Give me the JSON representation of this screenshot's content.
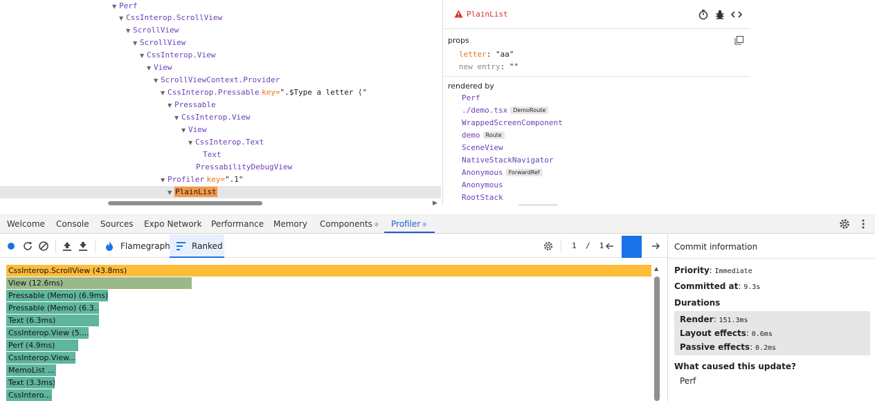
{
  "tree": {
    "rows": [
      {
        "name": "Perf"
      },
      {
        "name": "CssInterop.ScrollView"
      },
      {
        "name": "ScrollView"
      },
      {
        "name": "ScrollView"
      },
      {
        "name": "CssInterop.View"
      },
      {
        "name": "View"
      },
      {
        "name": "ScrollViewContext.Provider"
      },
      {
        "name": "CssInterop.Pressable",
        "key_label": "key=",
        "key_value": "\".$Type a letter ⟨\""
      },
      {
        "name": "Pressable"
      },
      {
        "name": "CssInterop.View"
      },
      {
        "name": "View"
      },
      {
        "name": "CssInterop.Text"
      },
      {
        "name": "Text"
      },
      {
        "name": "PressabilityDebugView"
      },
      {
        "name": "Profiler",
        "key_label": "key=",
        "key_value": "\".1\""
      },
      {
        "name": "PlainList"
      }
    ]
  },
  "inspector": {
    "title": "PlainList",
    "icons": [
      "stopwatch-icon",
      "bug-icon",
      "code-icon"
    ],
    "props_title": "props",
    "props": [
      {
        "key": "letter",
        "value": "\"aa\""
      },
      {
        "key": "new entry",
        "value": "\"\""
      }
    ],
    "rendered_by_title": "rendered by",
    "owners": [
      {
        "name": "Perf",
        "badge": ""
      },
      {
        "name": "./demo.tsx",
        "badge": "DemoRoute"
      },
      {
        "name": "WrappedScreenComponent",
        "badge": ""
      },
      {
        "name": "demo",
        "badge": "Route"
      },
      {
        "name": "SceneView",
        "badge": ""
      },
      {
        "name": "NativeStackNavigator",
        "badge": ""
      },
      {
        "name": "Anonymous",
        "badge": "ForwardRef"
      },
      {
        "name": "Anonymous",
        "badge": ""
      },
      {
        "name": "RootStack",
        "badge": ""
      }
    ]
  },
  "devtools_tabs": [
    {
      "label": "Welcome"
    },
    {
      "label": "Console"
    },
    {
      "label": "Sources"
    },
    {
      "label": "Expo Network"
    },
    {
      "label": "Performance"
    },
    {
      "label": "Memory"
    },
    {
      "label": "Components",
      "glyph": "⚛"
    },
    {
      "label": "Profiler",
      "glyph": "⚛",
      "active": true
    }
  ],
  "profiler_toolbar": {
    "flamegraph_label": "Flamegraph",
    "ranked_label": "Ranked",
    "commit_current": "1",
    "commit_separator": "/",
    "commit_total": "1"
  },
  "chart_data": {
    "type": "bar",
    "orientation": "horizontal",
    "title": "",
    "categories": [
      "CssInterop.ScrollView (43.8ms)",
      "View (12.6ms)",
      "Pressable (Memo) (6.9ms)",
      "Pressable (Memo) (6.3...",
      "Text (6.3ms)",
      "CssInterop.View (5....",
      "Perf (4.9ms)",
      "CssInterop.View...",
      "MemoList ...",
      "Text (3.3ms)",
      "CssIntero..."
    ],
    "values": [
      43.8,
      12.6,
      6.9,
      6.3,
      6.3,
      5.6,
      4.9,
      4.7,
      3.4,
      3.3,
      3.1
    ],
    "colors": [
      "#ffbc3b",
      "#9ab98a",
      "#5fb59d",
      "#5fb59d",
      "#5fb59d",
      "#5fb59d",
      "#5fb59d",
      "#5fb59d",
      "#5fb59d",
      "#5fb59d",
      "#5fb59d"
    ],
    "xlim": [
      0,
      43.8
    ]
  },
  "commit_info": {
    "title": "Commit information",
    "priority_label": "Priority",
    "priority_value": "Immediate",
    "committed_label": "Committed at",
    "committed_value": "9.3s",
    "durations_label": "Durations",
    "render_label": "Render",
    "render_value": "151.3ms",
    "layout_label": "Layout effects",
    "layout_value": "0.6ms",
    "passive_label": "Passive effects",
    "passive_value": "0.2ms",
    "cause_label": "What caused this update?",
    "cause_item": "Perf"
  },
  "colors": {
    "accent": "#1a73e8",
    "component_name": "#6a3fb8",
    "prop_key": "#e8731b",
    "warning": "#d93025",
    "selected_name_bg": "#f29a4a"
  }
}
